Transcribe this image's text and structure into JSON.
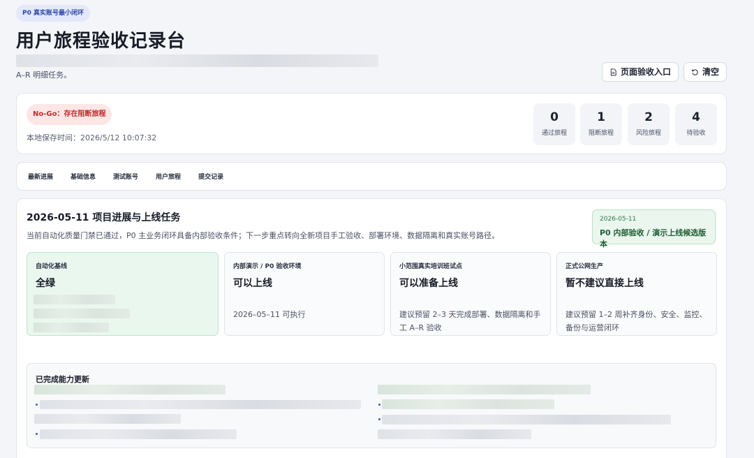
{
  "header": {
    "badge": "P0 真实账号最小闭环",
    "title": "用户旅程验收记录台",
    "subtitle": "A–R 明细任务。",
    "buttons": {
      "page_check": "页面验收入口",
      "clear": "清空"
    }
  },
  "status": {
    "pill": "No-Go：存在阻断旅程",
    "saved_time": "本地保存时间：2026/5/12 10:07:32",
    "stats": [
      {
        "value": "0",
        "label": "通过旅程"
      },
      {
        "value": "1",
        "label": "阻断旅程"
      },
      {
        "value": "2",
        "label": "风险旅程"
      },
      {
        "value": "4",
        "label": "待验收"
      }
    ]
  },
  "tabs": [
    "最新进展",
    "基础信息",
    "测试账号",
    "用户旅程",
    "提交记录"
  ],
  "progress": {
    "title": "2026-05-11 项目进展与上线任务",
    "desc": "当前自动化质量门禁已通过，P0 主业务闭环具备内部验收条件；下一步重点转向全新项目手工验收、部署环境、数据隔离和真实账号路径。",
    "version": {
      "date": "2026-05-11",
      "label": "P0 内部验收 / 演示上线候选版本"
    },
    "cards": [
      {
        "key": "自动化基线",
        "value": "全绿",
        "note": ""
      },
      {
        "key": "内部演示 / P0 验收环境",
        "value": "可以上线",
        "note": "2026–05–11 可执行"
      },
      {
        "key": "小范围真实培训班试点",
        "value": "可以准备上线",
        "note": "建议预留 2–3 天完成部署、数据隔离和手工 A–R 验收"
      },
      {
        "key": "正式公网生产",
        "value": "暂不建议直接上线",
        "note": "建议预留 1–2 周补齐身份、安全、监控、备份与运营闭环"
      }
    ],
    "done_title": "已完成能力更新"
  }
}
